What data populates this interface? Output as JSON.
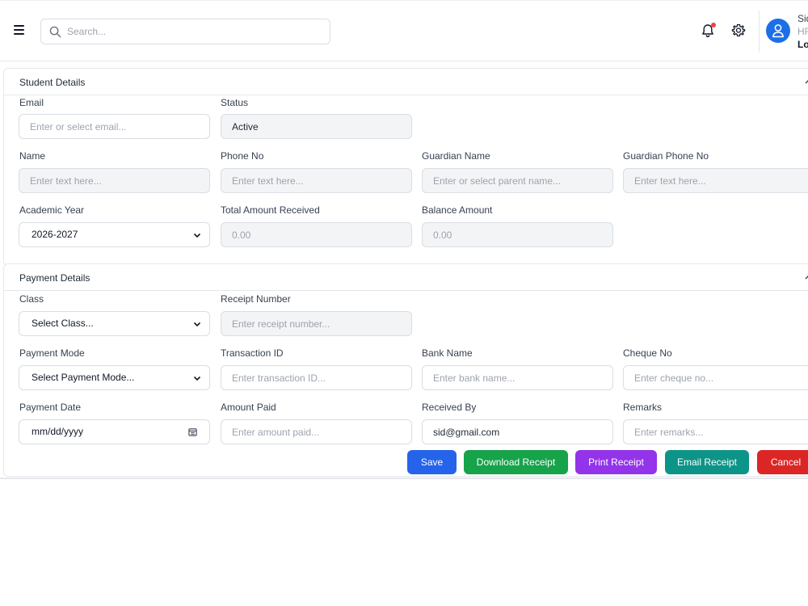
{
  "header": {
    "search_placeholder": "Search...",
    "user": {
      "name": "Sid",
      "role": "HR",
      "logout": "Logout"
    }
  },
  "student_section": {
    "title": "Student Details",
    "fields": {
      "email": {
        "label": "Email",
        "placeholder": "Enter or select email..."
      },
      "status": {
        "label": "Status",
        "value": "Active"
      },
      "name": {
        "label": "Name",
        "placeholder": "Enter text here..."
      },
      "phone": {
        "label": "Phone No",
        "placeholder": "Enter text here..."
      },
      "guardian_name": {
        "label": "Guardian Name",
        "placeholder": "Enter or select parent name..."
      },
      "guardian_phone": {
        "label": "Guardian Phone No",
        "placeholder": "Enter text here..."
      },
      "academic_year": {
        "label": "Academic Year",
        "value": "2026-2027"
      },
      "total_received": {
        "label": "Total Amount Received",
        "placeholder": "0.00"
      },
      "balance": {
        "label": "Balance Amount",
        "placeholder": "0.00"
      }
    }
  },
  "payment_section": {
    "title": "Payment Details",
    "fields": {
      "class": {
        "label": "Class",
        "value": "Select Class..."
      },
      "receipt_number": {
        "label": "Receipt Number",
        "placeholder": "Enter receipt number..."
      },
      "payment_mode": {
        "label": "Payment Mode",
        "value": "Select Payment Mode..."
      },
      "transaction_id": {
        "label": "Transaction ID",
        "placeholder": "Enter transaction ID..."
      },
      "bank_name": {
        "label": "Bank Name",
        "placeholder": "Enter bank name..."
      },
      "cheque_no": {
        "label": "Cheque No",
        "placeholder": "Enter cheque no..."
      },
      "payment_date": {
        "label": "Payment Date",
        "value": "mm/dd/yyyy"
      },
      "amount_paid": {
        "label": "Amount Paid",
        "placeholder": "Enter amount paid..."
      },
      "received_by": {
        "label": "Received By",
        "value": "sid@gmail.com"
      },
      "remarks": {
        "label": "Remarks",
        "placeholder": "Enter remarks..."
      }
    }
  },
  "actions": {
    "save": "Save",
    "download": "Download Receipt",
    "print": "Print Receipt",
    "email": "Email Receipt",
    "cancel": "Cancel"
  },
  "colors": {
    "save": "#2563eb",
    "download": "#16a34a",
    "print": "#9333ea",
    "email": "#0d9488",
    "cancel": "#dc2626",
    "avatar": "#1d6fe8",
    "notification_dot": "#ef4444"
  },
  "icons": [
    "menu-icon",
    "search-icon",
    "bell-icon",
    "gear-icon",
    "user-icon",
    "chevron-up-icon",
    "chevron-down-icon",
    "calendar-icon"
  ]
}
